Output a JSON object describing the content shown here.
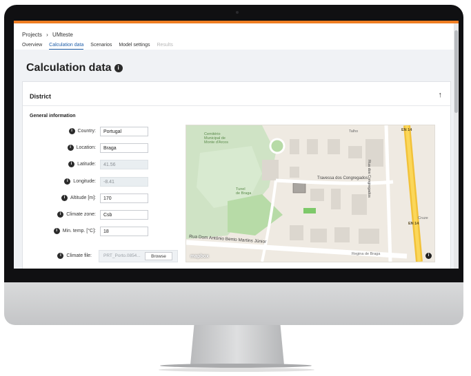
{
  "breadcrumb": {
    "projects": "Projects",
    "separator": "›",
    "current": "UMteste"
  },
  "tabs": [
    {
      "label": "Overview"
    },
    {
      "label": "Calculation data"
    },
    {
      "label": "Scenarios"
    },
    {
      "label": "Model settings"
    },
    {
      "label": "Results"
    }
  ],
  "page": {
    "title": "Calculation data",
    "info": "i"
  },
  "district": {
    "title": "District",
    "collapse_icon": "↑"
  },
  "section": {
    "title": "General information"
  },
  "fields": {
    "country": {
      "label": "Country:",
      "value": "Portugal"
    },
    "location": {
      "label": "Location:",
      "value": "Braga"
    },
    "latitude": {
      "label": "Latitude:",
      "value": "41.56"
    },
    "longitude": {
      "label": "Longitude:",
      "value": "-8.41"
    },
    "altitude": {
      "label": "Altitude [m]:",
      "value": "170"
    },
    "climate_zone": {
      "label": "Climate zone:",
      "value": "Csb"
    },
    "min_temp": {
      "label": "Min. temp. [°C]:",
      "value": "18"
    },
    "climate_file": {
      "label": "Climate file:",
      "value": "PRT_Porto.0854...",
      "browse": "Browse"
    }
  },
  "map": {
    "labels": {
      "cemetery": "Cemitério\nMunicipal de\nMonte d'Arcos",
      "tunnel": "Tunel\nde Braga",
      "travessa": "Travessa dos Congregados",
      "rua_congregados": "Rua dos Congregados",
      "rua_dom": "Rua Dom António Bento Martins Júnior",
      "regina": "Regina de Braga",
      "en14_a": "EN 14",
      "en14_b": "EN 14",
      "talho": "Talho",
      "cruze": "Cruze"
    },
    "logo": "mapbox",
    "info": "i"
  },
  "colors": {
    "accent": "#ef7d22",
    "tab_active": "#1e5da8"
  }
}
